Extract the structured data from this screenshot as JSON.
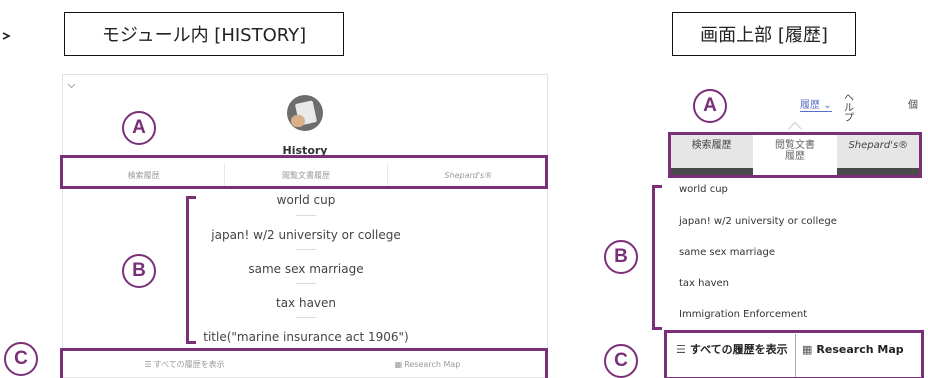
{
  "titles": {
    "left": "モジュール内 [HISTORY]",
    "right": "画面上部 [履歴]"
  },
  "module": {
    "title": "History",
    "tabs": [
      "検索履歴",
      "閲覧文書履歴",
      "Shepard's®"
    ],
    "items": [
      "world cup",
      "japan! w/2 university or college",
      "same sex marriage",
      "tax haven",
      "title(\"marine insurance act 1906\")"
    ],
    "footer": {
      "show_all": "すべての履歴を表示",
      "research_map": "Research Map"
    },
    "icons": [
      "chevron-down-icon",
      "history-icon",
      "list-icon",
      "map-icon"
    ]
  },
  "header": {
    "history_dropdown": "履歴",
    "help": "ヘルプ",
    "extra": "個"
  },
  "panel": {
    "tabs": [
      {
        "lines": [
          "検索履歴"
        ]
      },
      {
        "lines": [
          "閲覧文書",
          "履歴"
        ]
      },
      {
        "lines": [
          "Shepard's®"
        ]
      }
    ],
    "items": [
      "world cup",
      "japan! w/2 university or college",
      "same sex marriage",
      "tax haven",
      "Immigration Enforcement"
    ],
    "footer": {
      "show_all": "すべての履歴を表示",
      "research_map": "Research Map"
    }
  },
  "callouts": [
    "A",
    "B",
    "C"
  ],
  "colors": {
    "highlight": "#7a2f78",
    "link": "#5b6ec7",
    "tab_bar_dark": "#4a4a4a",
    "tab_bg": "#e6e6e6"
  }
}
